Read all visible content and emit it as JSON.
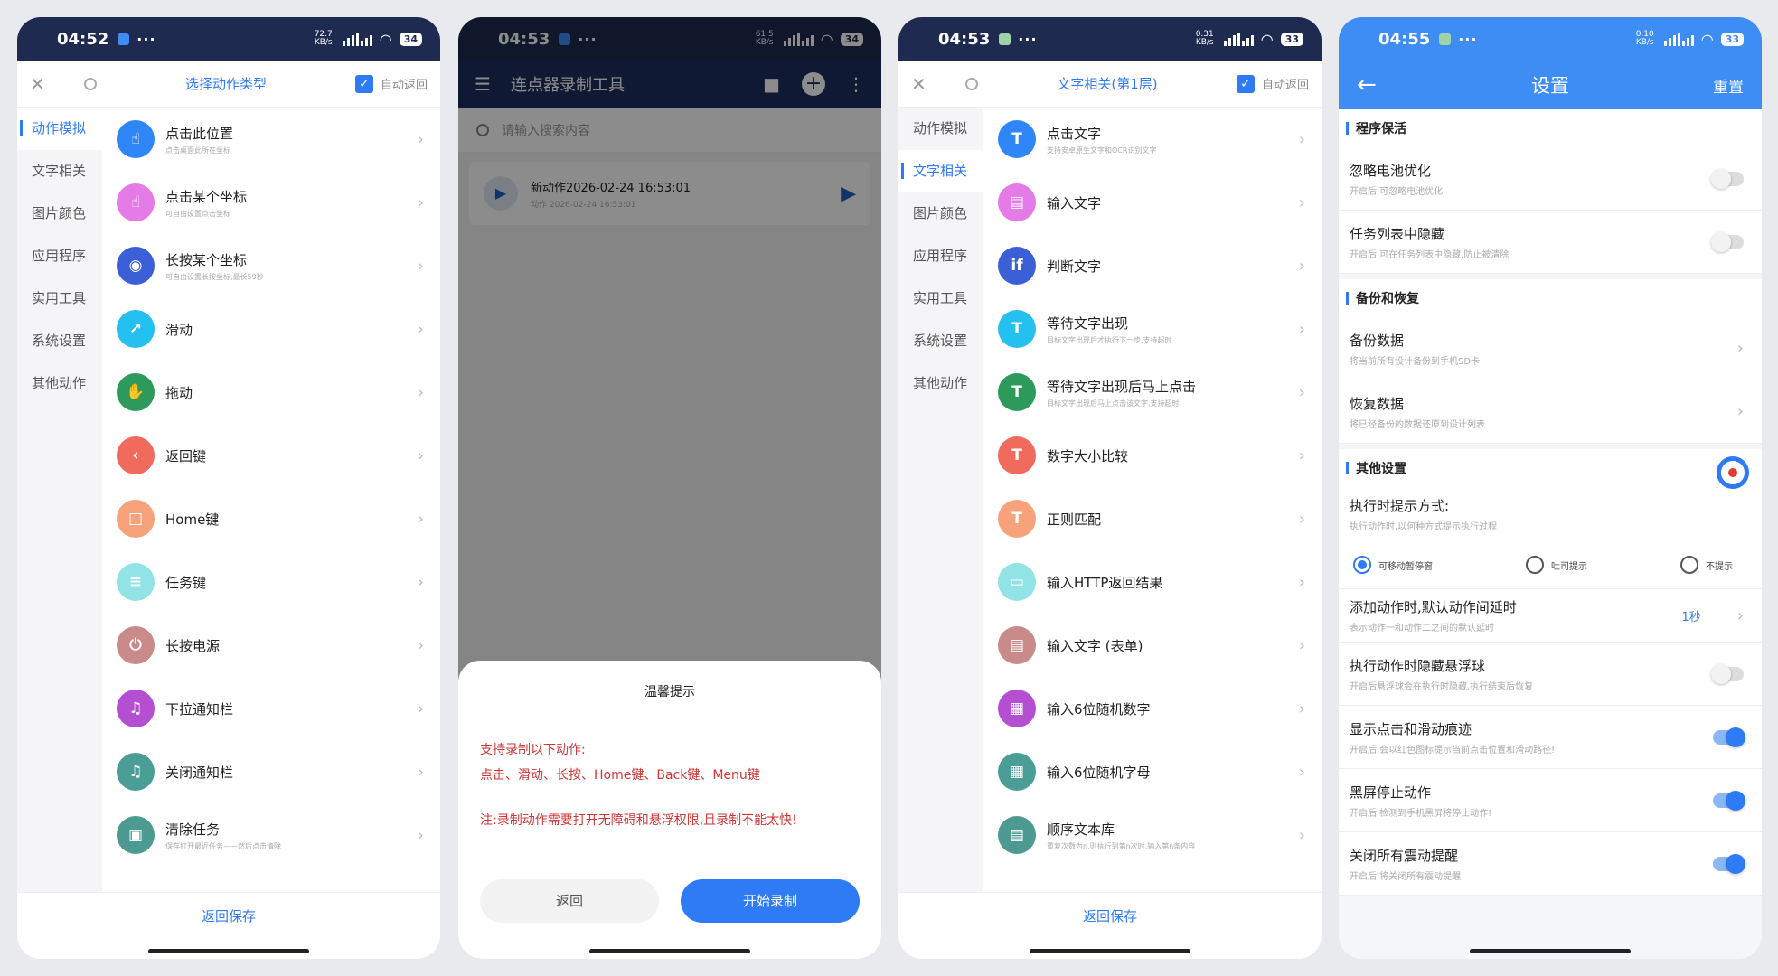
{
  "colors": {
    "accent": "#2f7af5",
    "dark_status": "#1e2a4f",
    "settings_blue": "#3d8df5"
  },
  "phone1": {
    "status": {
      "time": "04:52",
      "net_speed": "72.7 KB/s",
      "battery": "34"
    },
    "header": {
      "title": "选择动作类型",
      "auto_return": "自动返回"
    },
    "categories": [
      "动作模拟",
      "文字相关",
      "图片颜色",
      "应用程序",
      "实用工具",
      "系统设置",
      "其他动作"
    ],
    "items": [
      {
        "title": "点击此位置",
        "sub": "点击桌面此所在坐标",
        "color": "#2f86f6",
        "glyph": "☝"
      },
      {
        "title": "点击某个坐标",
        "sub": "可自由设置点击坐标",
        "color": "#e47be6",
        "glyph": "☝"
      },
      {
        "title": "长按某个坐标",
        "sub": "可自由设置长按坐标,最长59秒",
        "color": "#3a5fd6",
        "glyph": "◉"
      },
      {
        "title": "滑动",
        "sub": "",
        "color": "#23c0f0",
        "glyph": "↗"
      },
      {
        "title": "拖动",
        "sub": "",
        "color": "#2d9a5c",
        "glyph": "✋"
      },
      {
        "title": "返回键",
        "sub": "",
        "color": "#f06a5e",
        "glyph": "‹"
      },
      {
        "title": "Home键",
        "sub": "",
        "color": "#f7a27a",
        "glyph": "□"
      },
      {
        "title": "任务键",
        "sub": "",
        "color": "#92e3e6",
        "glyph": "≡"
      },
      {
        "title": "长按电源",
        "sub": "",
        "color": "#c98a8a",
        "glyph": "⏻"
      },
      {
        "title": "下拉通知栏",
        "sub": "",
        "color": "#b44fd1",
        "glyph": "♫"
      },
      {
        "title": "关闭通知栏",
        "sub": "",
        "color": "#4b9e96",
        "glyph": "♫"
      },
      {
        "title": "清除任务",
        "sub": "保存打开最近任务——然后点击清除",
        "color": "#4d9a92",
        "glyph": "▣"
      }
    ],
    "footer": "返回保存"
  },
  "phone2": {
    "status": {
      "time": "04:53",
      "net_speed": "61.5 KB/s",
      "battery": "34"
    },
    "header": {
      "title": "连点器录制工具"
    },
    "search": {
      "placeholder": "请输入搜索内容"
    },
    "record": {
      "name": "新动作2026-02-24 16:53:01",
      "sub": "动作 2026-02-24 16:53:01"
    },
    "dialog": {
      "title": "温馨提示",
      "line1": "支持录制以下动作:",
      "line2": "点击、滑动、长按、Home键、Back键、Menu键",
      "note": "注:录制动作需要打开无障碍和悬浮权限,且录制不能太快!",
      "cancel": "返回",
      "start": "开始录制"
    }
  },
  "phone3": {
    "status": {
      "time": "04:53",
      "net_speed": "0.31 KB/s",
      "battery": "33"
    },
    "header": {
      "title": "文字相关(第1层)",
      "auto_return": "自动返回"
    },
    "items": [
      {
        "title": "点击文字",
        "sub": "支持安卓原生文字和OCR识别文字",
        "color": "#2f86f6",
        "glyph": "T"
      },
      {
        "title": "输入文字",
        "sub": "",
        "color": "#e47be6",
        "glyph": "▤"
      },
      {
        "title": "判断文字",
        "sub": "",
        "color": "#3a5fd6",
        "glyph": "if"
      },
      {
        "title": "等待文字出现",
        "sub": "目标文字出现后才执行下一步,支持超时",
        "color": "#23c0f0",
        "glyph": "T"
      },
      {
        "title": "等待文字出现后马上点击",
        "sub": "目标文字出现后马上点击该文字,支持超时",
        "color": "#2d9a5c",
        "glyph": "T"
      },
      {
        "title": "数字大小比较",
        "sub": "",
        "color": "#f06a5e",
        "glyph": "T"
      },
      {
        "title": "正则匹配",
        "sub": "",
        "color": "#f7a27a",
        "glyph": "T"
      },
      {
        "title": "输入HTTP返回结果",
        "sub": "",
        "color": "#92e3e6",
        "glyph": "▭"
      },
      {
        "title": "输入文字 (表单)",
        "sub": "",
        "color": "#c98a8a",
        "glyph": "▤"
      },
      {
        "title": "输入6位随机数字",
        "sub": "",
        "color": "#b44fd1",
        "glyph": "▦"
      },
      {
        "title": "输入6位随机字母",
        "sub": "",
        "color": "#4b9e96",
        "glyph": "▦"
      },
      {
        "title": "顺序文本库",
        "sub": "重复次数为n,则执行到第n次时,输入第n条内容",
        "color": "#4d9a92",
        "glyph": "▤"
      }
    ],
    "footer": "返回保存"
  },
  "phone4": {
    "status": {
      "time": "04:55",
      "net_speed": "0.10 KB/s",
      "battery": "33"
    },
    "header": {
      "title": "设置",
      "reset": "重置"
    },
    "sections": {
      "keepalive": "程序保活",
      "backup": "备份和恢复",
      "other": "其他设置"
    },
    "battery_opt": {
      "title": "忽略电池优化",
      "sub": "开启后,可忽略电池优化",
      "on": false
    },
    "hide_task": {
      "title": "任务列表中隐藏",
      "sub": "开启后,可在任务列表中隐藏,防止被清除",
      "on": false
    },
    "backup_data": {
      "title": "备份数据",
      "sub": "将当前所有设计备份到手机SD卡"
    },
    "restore_data": {
      "title": "恢复数据",
      "sub": "将已经备份的数据还原到设计列表"
    },
    "prompt_mode": {
      "title": "执行时提示方式:",
      "sub": "执行动作时,以何种方式提示执行过程",
      "options": [
        "可移动暂停窗",
        "吐司提示",
        "不提示"
      ],
      "selected": 0
    },
    "delay": {
      "title": "添加动作时,默认动作间延时",
      "sub": "表示动作一和动作二之间的默认延时",
      "value": "1秒"
    },
    "hide_float": {
      "title": "执行动作时隐藏悬浮球",
      "sub": "开启后悬浮球会在执行时隐藏,执行结束后恢复",
      "on": false
    },
    "show_trace": {
      "title": "显示点击和滑动痕迹",
      "sub": "开启后,会以红色图标提示当前点击位置和滑动路径!",
      "on": true
    },
    "screen_off": {
      "title": "黑屏停止动作",
      "sub": "开启后,检测到手机黑屏将停止动作!",
      "on": true
    },
    "vibration": {
      "title": "关闭所有震动提醒",
      "sub": "开启后,将关闭所有震动提醒",
      "on": true
    }
  }
}
